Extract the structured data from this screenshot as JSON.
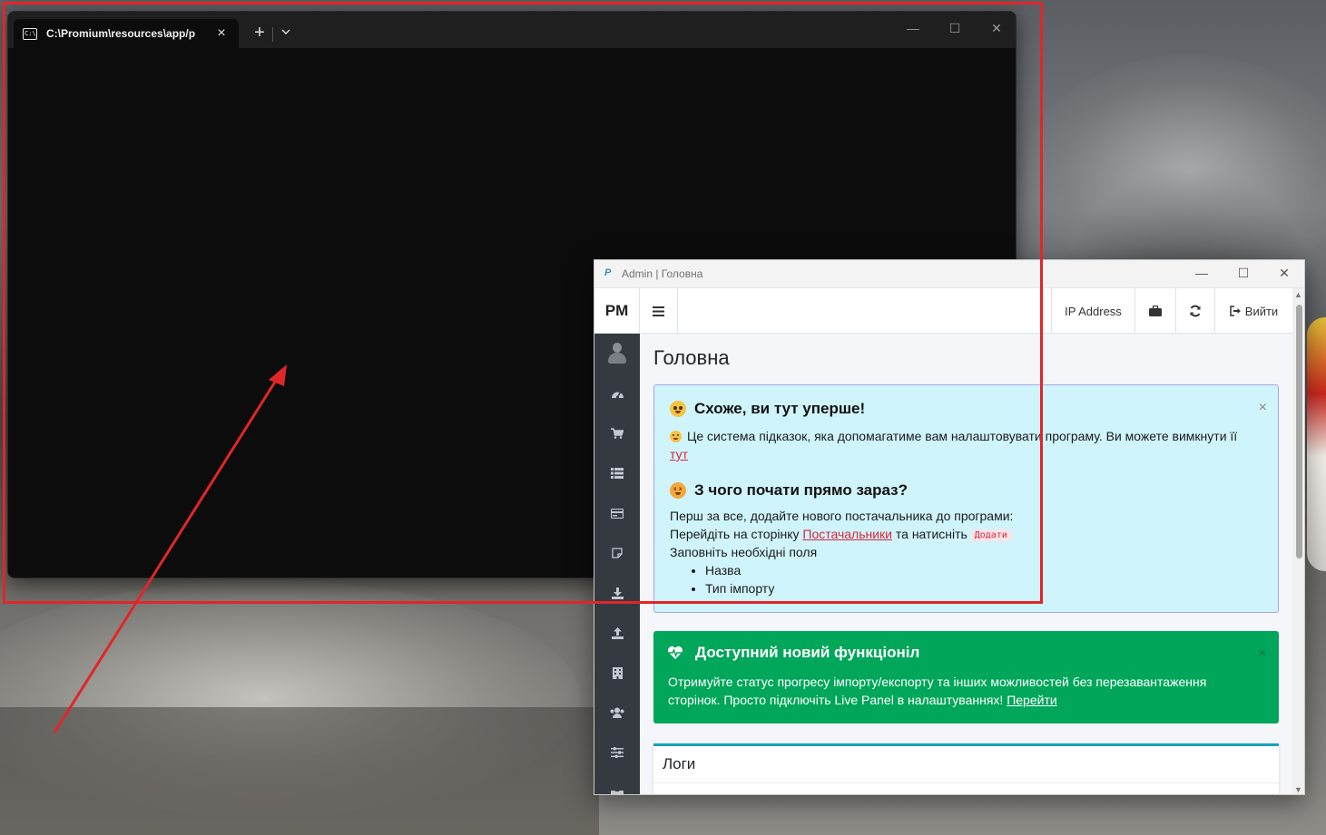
{
  "terminal": {
    "tab_title": "C:\\Promium\\resources\\app/p",
    "tab_icon": "terminal-icon",
    "new_tab": "+",
    "close_tab": "×",
    "minimize": "—",
    "maximize": "☐",
    "close": "✕"
  },
  "annotation": {
    "color": "#e0262a"
  },
  "app": {
    "window_title": "Admin | Головна",
    "window_icon": "P",
    "minimize": "—",
    "maximize": "☐",
    "close": "✕",
    "brand": "PM",
    "navbar": {
      "ip_label": "IP Address",
      "logout_label": "Вийти"
    },
    "sidebar_icons": [
      "user-avatar-icon",
      "dashboard-icon",
      "cart-icon",
      "list-icon",
      "card-icon",
      "note-icon",
      "download-icon",
      "upload-icon",
      "building-icon",
      "users-icon",
      "sliders-icon",
      "binoculars-icon"
    ],
    "page_title": "Головна",
    "info_callout": {
      "title": "Схоже, ви тут уперше!",
      "intro": "Це система підказок, яка допомагатиме вам налаштовувати програму. Ви можете вимкнути її",
      "intro_link": "тут",
      "subtitle": "З чого почати прямо зараз?",
      "step1": "Перш за все, додайте нового постачальника до програми:",
      "step2_prefix": "Перейдіть на сторінку",
      "step2_link": "Постачальники",
      "step2_suffix": "та натисніть",
      "step2_button": "Додати",
      "step3": "Заповніть необхідні поля",
      "fields": [
        "Назва",
        "Тип імпорту"
      ],
      "close": "×"
    },
    "success_callout": {
      "title": "Доступний новий функціонал",
      "title_display": "Доступний новий функціоніл",
      "text": "Отримуйте статус прогресу імпорту/експорту та інших можливостей без перезавантаження сторінок. Просто підключіть Live Panel в налаштуваннях!",
      "link": "Перейти",
      "close": "×",
      "color": "#00a65a"
    },
    "logs_card": {
      "title": "Логи",
      "accent": "#17a2b8"
    },
    "info_color": "#cff4fc",
    "sidebar_color": "#343a40"
  }
}
